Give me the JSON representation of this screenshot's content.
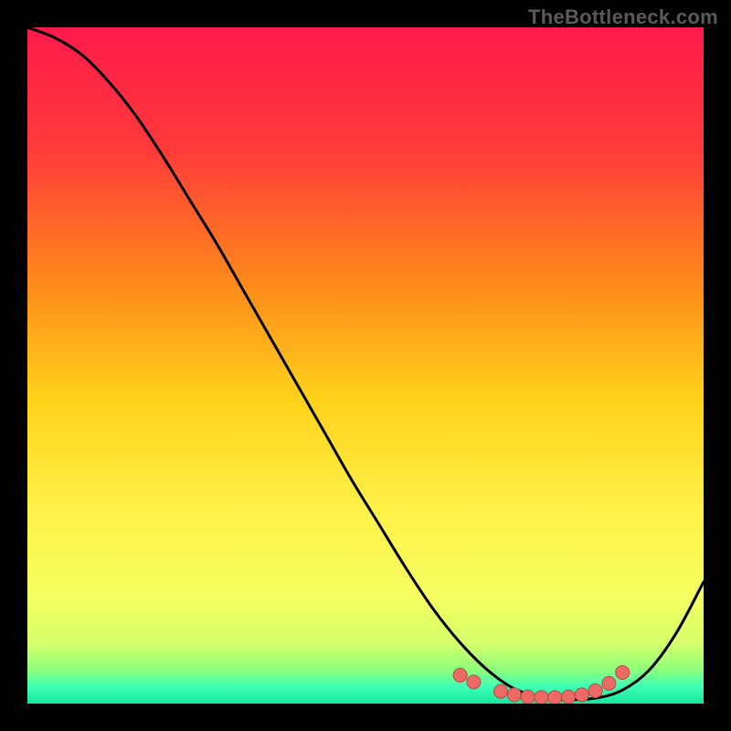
{
  "watermark": "TheBottleneck.com",
  "chart_data": {
    "type": "line",
    "title": "",
    "xlabel": "",
    "ylabel": "",
    "xlim": [
      0,
      100
    ],
    "ylim": [
      0,
      100
    ],
    "grid": false,
    "series": [
      {
        "name": "curve",
        "x": [
          0,
          4,
          8,
          12,
          16,
          20,
          24,
          28,
          32,
          36,
          40,
          44,
          48,
          52,
          56,
          60,
          64,
          68,
          72,
          76,
          80,
          84,
          88,
          92,
          96,
          100
        ],
        "y": [
          100,
          98.5,
          96,
          92,
          87,
          81,
          74.5,
          68,
          61,
          54,
          47,
          40,
          33,
          26.5,
          20,
          14,
          9,
          5,
          2.2,
          1,
          0.6,
          0.8,
          2,
          5,
          10.5,
          18
        ]
      }
    ],
    "markers": {
      "name": "bottom-dots",
      "x": [
        64,
        66,
        70,
        72,
        74,
        76,
        78,
        80,
        82,
        84,
        86,
        88
      ],
      "y": [
        4.2,
        3.2,
        1.8,
        1.3,
        1.0,
        0.9,
        0.9,
        1.0,
        1.3,
        1.9,
        3.0,
        4.6
      ]
    },
    "background_gradient": {
      "stops": [
        {
          "offset": 0.0,
          "color": "#ff1a4b"
        },
        {
          "offset": 0.18,
          "color": "#ff3a3a"
        },
        {
          "offset": 0.38,
          "color": "#ff8a1a"
        },
        {
          "offset": 0.55,
          "color": "#ffd21a"
        },
        {
          "offset": 0.72,
          "color": "#fff24a"
        },
        {
          "offset": 0.84,
          "color": "#f6ff60"
        },
        {
          "offset": 0.91,
          "color": "#d6ff6a"
        },
        {
          "offset": 0.95,
          "color": "#8dff7a"
        },
        {
          "offset": 0.975,
          "color": "#3dffb6"
        },
        {
          "offset": 1.0,
          "color": "#17e89e"
        }
      ]
    },
    "colors": {
      "curve": "#000000",
      "marker_fill": "#ec6a63",
      "marker_stroke": "#b84a44"
    }
  }
}
